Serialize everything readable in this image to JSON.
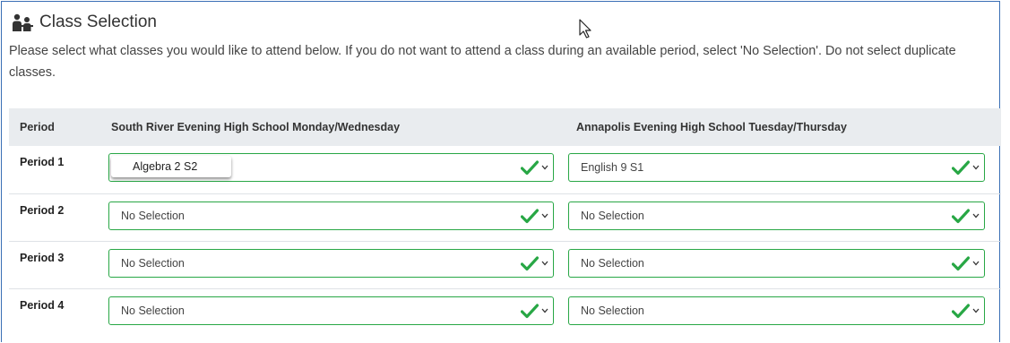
{
  "header": {
    "title": "Class Selection",
    "icon": "classroom-people-icon",
    "instructions": "Please select what classes you would like to attend below. If you do not want to attend a class during an available period, select 'No Selection'. Do not select duplicate classes."
  },
  "table": {
    "columns": [
      "Period",
      "South River Evening High School Monday/Wednesday",
      "Annapolis Evening High School Tuesday/Thursday"
    ],
    "rows": [
      {
        "period": "Period 1",
        "south_river": "Algebra 2 S2",
        "annapolis": "English 9 S1"
      },
      {
        "period": "Period 2",
        "south_river": "No Selection",
        "annapolis": "No Selection"
      },
      {
        "period": "Period 3",
        "south_river": "No Selection",
        "annapolis": "No Selection"
      },
      {
        "period": "Period 4",
        "south_river": "No Selection",
        "annapolis": "No Selection"
      }
    ]
  },
  "colors": {
    "valid_border": "#28a745",
    "check": "#28a745",
    "header_bg": "#e9ecef",
    "frame_border": "#3a6fb5"
  },
  "icons": {
    "valid": "checkmark-icon",
    "dropdown": "chevron-down-icon",
    "cursor": "mouse-cursor-icon"
  }
}
